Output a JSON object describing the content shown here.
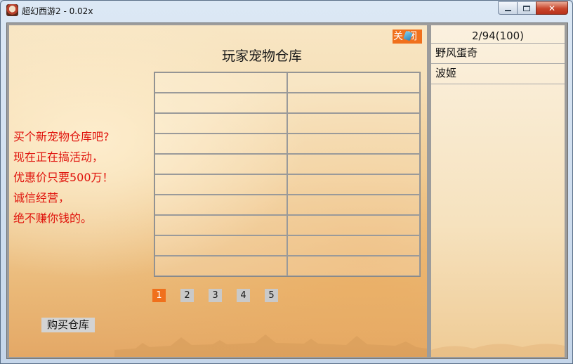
{
  "window": {
    "title": "超幻西游2 - 0.02x",
    "close_glyph": "✕"
  },
  "warehouse": {
    "title": "玩家宠物仓库",
    "close_label": "关闭",
    "rows": 10,
    "cols": 2
  },
  "promo": {
    "lines": [
      "买个新宠物仓库吧?",
      "现在正在搞活动，",
      "优惠价只要500万！",
      "诚信经营，",
      "绝不赚你钱的。"
    ]
  },
  "pager": {
    "pages": [
      "1",
      "2",
      "3",
      "4",
      "5"
    ],
    "active_page": "1"
  },
  "buy_button": {
    "label": "购买仓库"
  },
  "pet_panel": {
    "count": "2/94(100)",
    "pets": [
      "野风蛋奇",
      "波姬"
    ]
  },
  "colors": {
    "accent": "#f0701c",
    "promo_text": "#e0130c"
  }
}
